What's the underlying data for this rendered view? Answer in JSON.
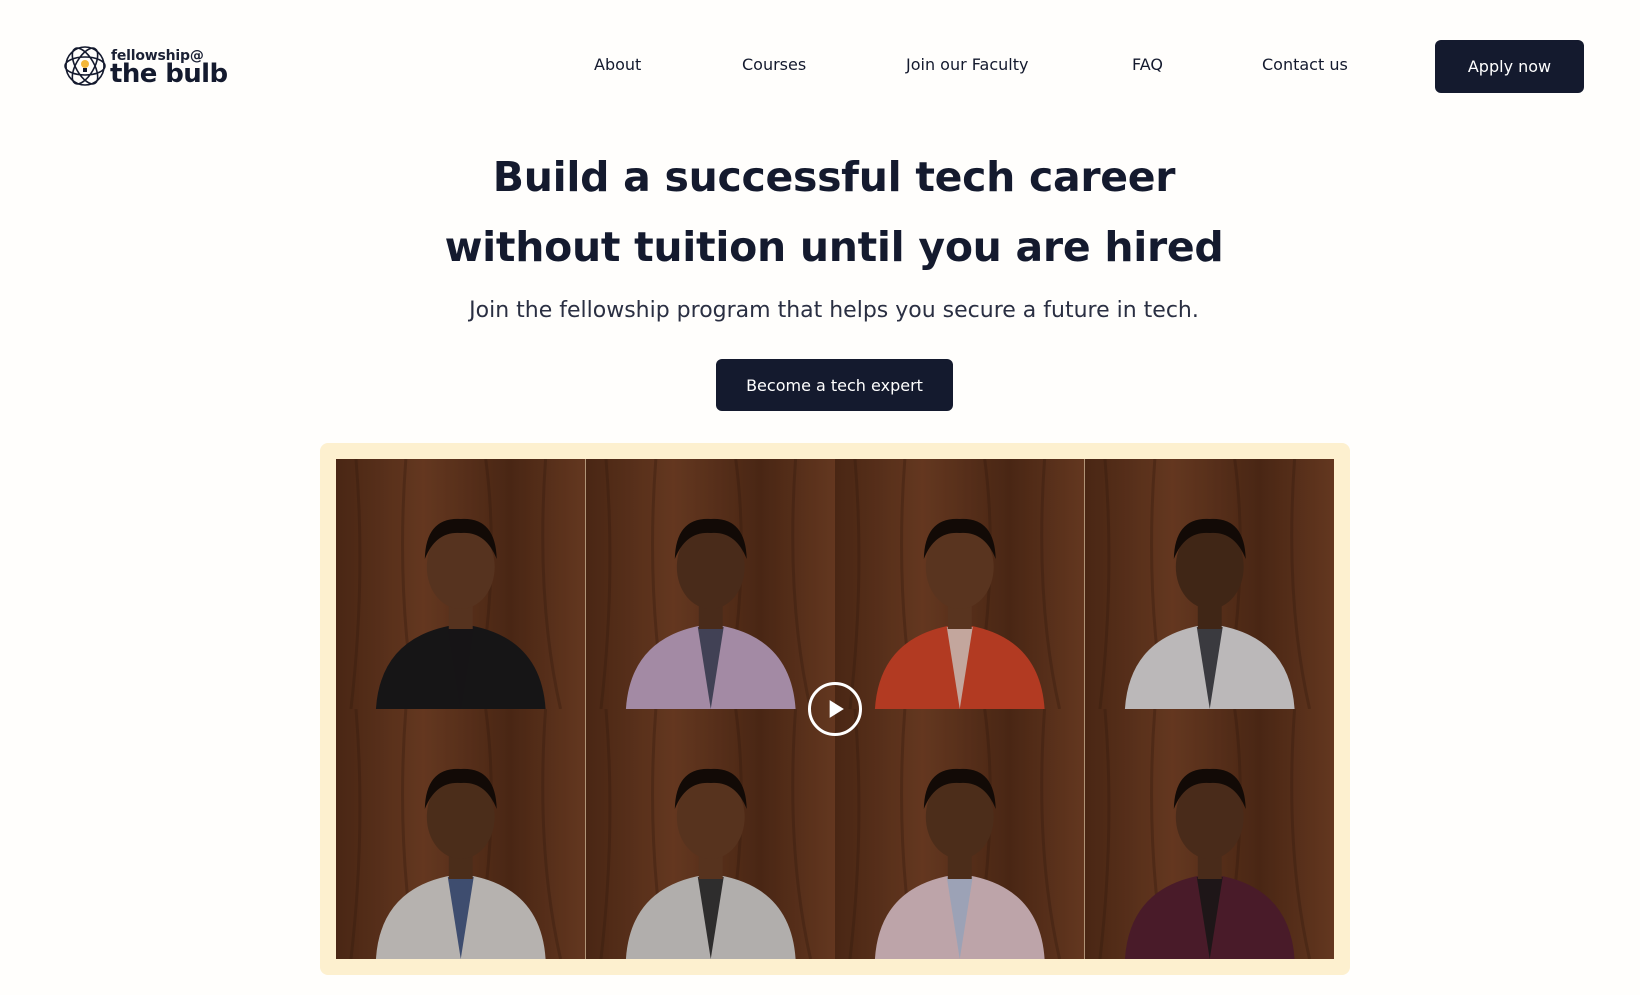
{
  "header": {
    "logo": {
      "small_text": "fellowship@",
      "big_text": "the bulb",
      "icon": "globe-bulb-icon"
    },
    "nav": [
      {
        "label": "About"
      },
      {
        "label": "Courses"
      },
      {
        "label": "Join our Faculty"
      },
      {
        "label": "FAQ"
      },
      {
        "label": "Contact us"
      }
    ],
    "apply_label": "Apply now"
  },
  "hero": {
    "title_line1": "Build a successful tech career",
    "title_line2": "without tuition until you are hired",
    "subtitle": "Join the fellowship program that helps you secure a future in tech.",
    "cta_label": "Become a tech expert"
  },
  "video": {
    "play_icon": "play-icon",
    "tiles": [
      {
        "attire": "black turtleneck",
        "skin": "#6a3f26",
        "clothes": "#1c1a1b",
        "accent": "#1c1a1b"
      },
      {
        "attire": "lilac shirt with striped tie",
        "skin": "#5a3520",
        "clothes": "#c7a9c8",
        "accent": "#3b4157"
      },
      {
        "attire": "red and white patterned blouse",
        "skin": "#6d4026",
        "clothes": "#d9472a",
        "accent": "#f1e3da"
      },
      {
        "attire": "white shirt with dark vest",
        "skin": "#4f2f1c",
        "clothes": "#e4e1e2",
        "accent": "#2c2c33"
      },
      {
        "attire": "white shirt with blue tie",
        "skin": "#5c3720",
        "clothes": "#dedad6",
        "accent": "#33487a"
      },
      {
        "attire": "houndstooth blazer",
        "skin": "#6b3f25",
        "clothes": "#d8d5d2",
        "accent": "#1d1b1c"
      },
      {
        "attire": "pink and blue shirt",
        "skin": "#5d3820",
        "clothes": "#e7c9cf",
        "accent": "#b7c5e0"
      },
      {
        "attire": "maroon blouse",
        "skin": "#5a3520",
        "clothes": "#5a2232",
        "accent": "#1c1a1b"
      }
    ],
    "colors": {
      "frame": "#fdf0cf",
      "wood": "#5a2f19",
      "wood_light": "#7a4427",
      "overlay_opacity": 0.18
    }
  },
  "colors": {
    "navy": "#141a2e",
    "background": "#fffefc"
  }
}
